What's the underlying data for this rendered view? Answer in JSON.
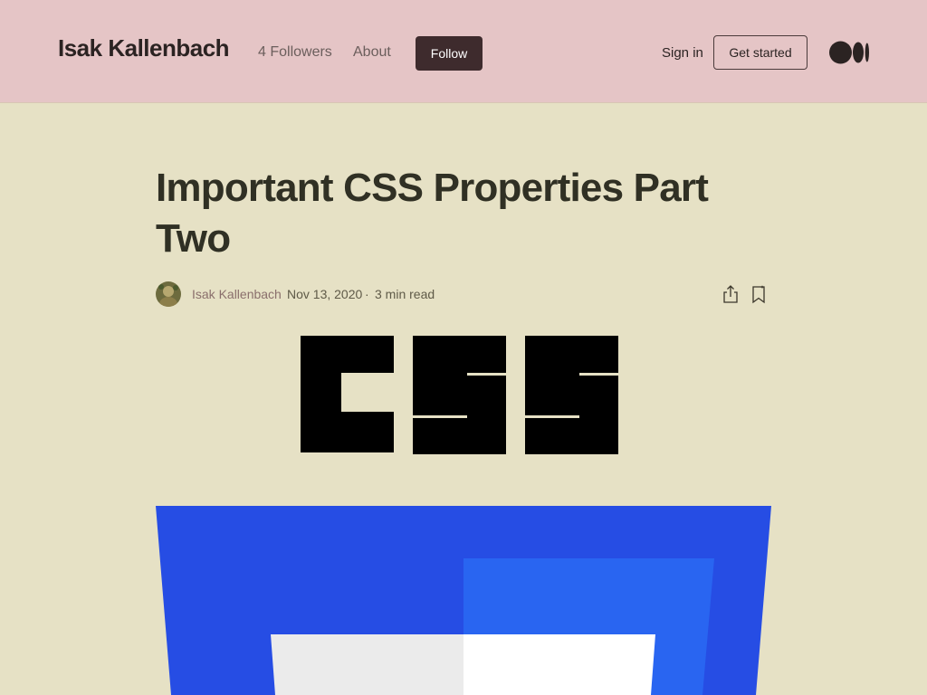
{
  "header": {
    "publication_title": "Isak Kallenbach",
    "followers_link": "4 Followers",
    "about_link": "About",
    "follow_button": "Follow",
    "sign_in_link": "Sign in",
    "get_started_button": "Get started",
    "logo_icon": "medium-logo-icon"
  },
  "article": {
    "title": "Important CSS Properties Part Two",
    "author": "Isak Kallenbach",
    "date": "Nov 13, 2020",
    "separator": "·",
    "read_time": "3 min read",
    "actions": {
      "share_icon": "share-icon",
      "bookmark_icon": "bookmark-icon"
    },
    "images": [
      {
        "name": "css-wordmark-image",
        "text": "CSS"
      },
      {
        "name": "css3-logo-image"
      }
    ]
  },
  "colors": {
    "header_bg": "#e5c5c6",
    "page_bg": "#e6e1c5",
    "follow_bg": "#3e2b2d",
    "title_text": "#303024",
    "css3_blue_dark": "#264de4",
    "css3_blue_light": "#2965f1"
  }
}
